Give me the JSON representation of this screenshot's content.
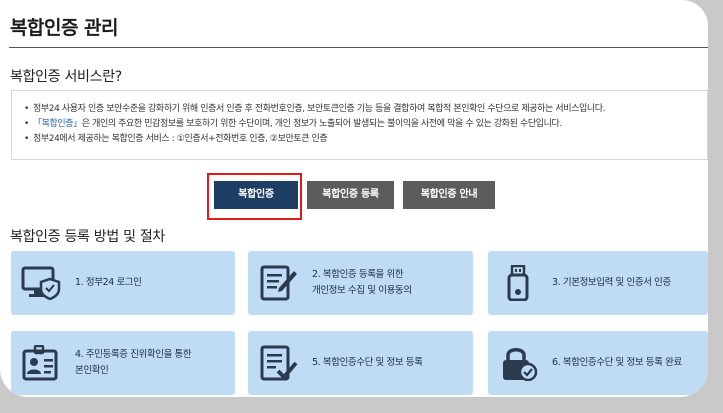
{
  "page_title": "복합인증 관리",
  "intro": {
    "title": "복합인증 서비스란?",
    "lines": {
      "l1": "정부24 사용자 인증 보안수준을 강화하기 위해 인증서 인증 후 전화번호인증, 보안토큰인증 기능 등을 결합하여 복합적 본인확인 수단으로 제공하는 서비스입니다.",
      "l2_highlight": "「복합인증」",
      "l2_rest": "은 개인의 주요한 민감정보를 보호하기 위한 수단이며, 개인 정보가 노출되어 발생되는 불이익을 사전에 막을 수 있는 강화된 수단입니다.",
      "l3": "정부24에서 제공하는 복합인증 서비스 : ①인증서+전화번호 인증, ②보안토큰 인증"
    },
    "bullet": "•"
  },
  "buttons": {
    "complex_auth": "복합인증",
    "register": "복합인증 등록",
    "guide": "복합인증 안내"
  },
  "procedure": {
    "title": "복합인증 등록 방법 및 절차",
    "steps": [
      {
        "label": "1. 정부24 로그인",
        "icon": "monitor-shield-icon"
      },
      {
        "label": "2. 복합인증 등록을 위한\n개인정보 수집 및 이용동의",
        "icon": "document-pen-icon"
      },
      {
        "label": "3. 기본정보입력 및 인증서 인증",
        "icon": "usb-token-icon"
      },
      {
        "label": "4. 주민등록증 진위확인을 통한\n본인확인",
        "icon": "id-card-icon"
      },
      {
        "label": "5. 복합인증수단 및 정보 등록",
        "icon": "document-check-icon"
      },
      {
        "label": "6. 복합인증수단 및 정보 등록 완료",
        "icon": "lock-check-icon"
      }
    ]
  },
  "colors": {
    "primary_button": "#1e3e66",
    "secondary_button": "#5c5c5c",
    "step_background": "#bfdcf4",
    "icon": "#2b3a4f",
    "highlight_frame": "#e01b1b",
    "link_text": "#2a63b5"
  }
}
